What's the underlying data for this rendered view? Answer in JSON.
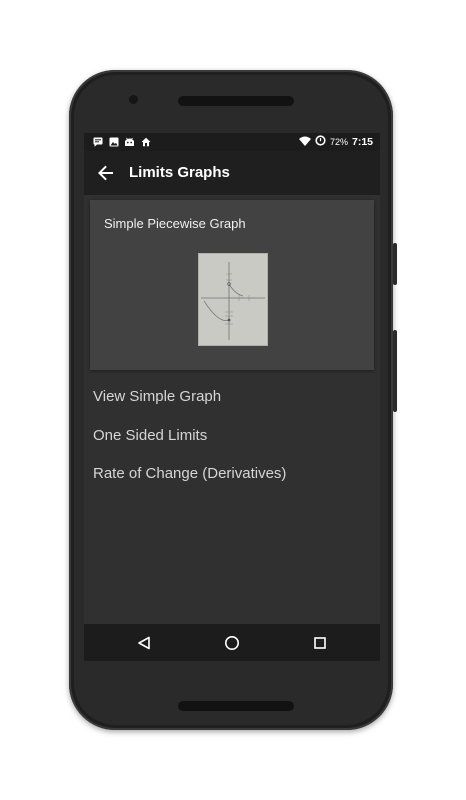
{
  "status_bar": {
    "notification_icons": [
      "message-icon",
      "image-icon",
      "android-icon",
      "home-icon"
    ],
    "battery_percent": "72%",
    "time": "7:15"
  },
  "app_bar": {
    "title": "Limits Graphs",
    "back_icon": "arrow-back-icon"
  },
  "card": {
    "title": "Simple Piecewise Graph",
    "image": "graph-thumbnail"
  },
  "menu": {
    "items": [
      {
        "label": "View Simple Graph"
      },
      {
        "label": "One Sided Limits"
      },
      {
        "label": "Rate of Change (Derivatives)"
      }
    ]
  },
  "nav_bar": {
    "icons": [
      "back-triangle-icon",
      "home-circle-icon",
      "recents-square-icon"
    ]
  },
  "colors": {
    "screen_bg": "#303030",
    "app_bar_bg": "#1f1f1f",
    "card_bg": "#424242",
    "text": "#d6d6d6"
  }
}
